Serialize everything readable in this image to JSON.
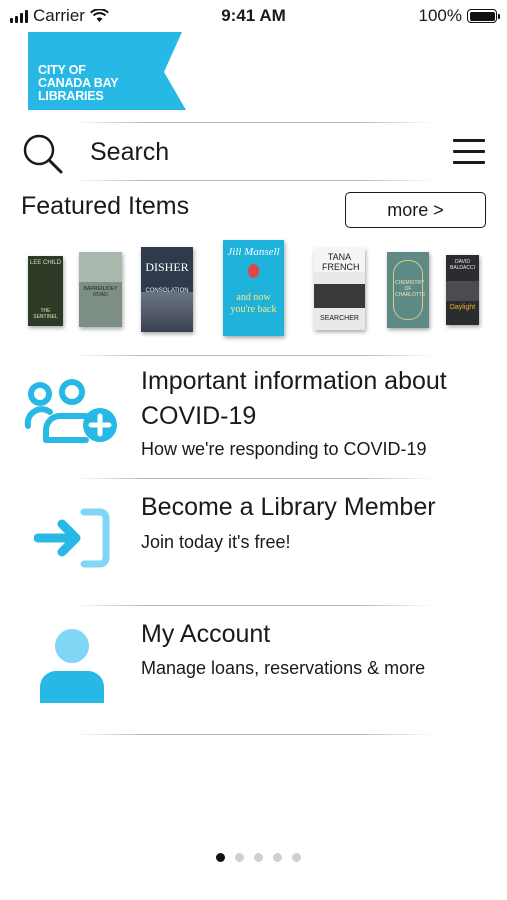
{
  "status_bar": {
    "carrier": "Carrier",
    "time": "9:41 AM",
    "battery": "100%"
  },
  "logo": {
    "line1": "CITY OF",
    "line2": "CANADA BAY",
    "line3": "LIBRARIES",
    "color": "#27b8e6"
  },
  "search": {
    "placeholder": "Search"
  },
  "featured": {
    "title": "Featured Items",
    "more_label": "more >",
    "books": [
      {
        "author": "LEE CHILD",
        "title": "THE SENTINEL",
        "color": "#2c3a26"
      },
      {
        "author": "",
        "title": "BARRENJOEY ROAD",
        "color": "#7d8f84"
      },
      {
        "author": "DISHER",
        "title": "CONSOLATION",
        "color": "#2f3a4c"
      },
      {
        "author": "Jill Mansell",
        "title": "and now you're back",
        "color": "#1fb3dc"
      },
      {
        "author": "TANA FRENCH",
        "title": "SEARCHER",
        "color": "#e9e9e9"
      },
      {
        "author": "",
        "title": "CHEMISTRY OF CHARLOTTE",
        "color": "#5e8a86"
      },
      {
        "author": "DAVID BALDACCI",
        "title": "Daylight",
        "color": "#2a2c30"
      }
    ]
  },
  "items": [
    {
      "icon": "users-plus-icon",
      "title_line1": "Important information about",
      "title_line2": "COVID-19",
      "subtitle": "How we're responding to COVID-19"
    },
    {
      "icon": "sign-in-icon",
      "title_line1": "Become a Library Member",
      "subtitle": "Join today it's free!"
    },
    {
      "icon": "user-icon",
      "title_line1": "My Account",
      "subtitle": "Manage loans, reservations & more"
    }
  ],
  "pager": {
    "pages": 5,
    "active": 1
  },
  "colors": {
    "accent": "#27b8e6",
    "accent_light": "#7fd6f5"
  }
}
